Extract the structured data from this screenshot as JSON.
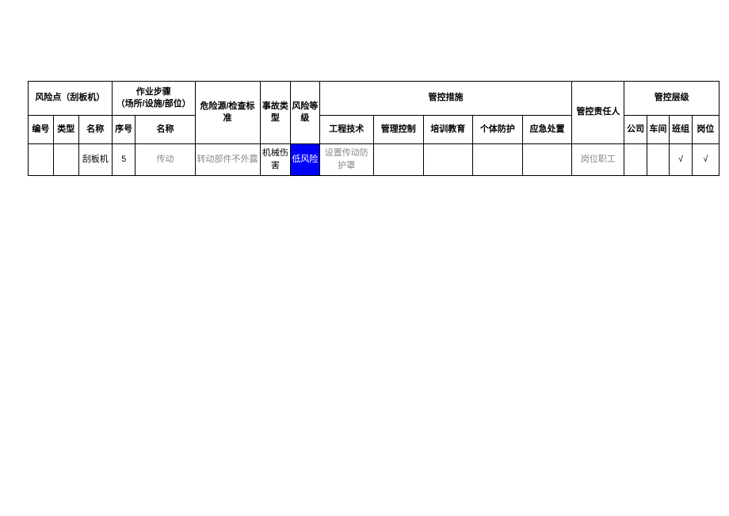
{
  "header": {
    "risk_point": "风险点（刮板机）",
    "operation_step": "作业步骤\n（场所/设施/部位）",
    "hazard_standard": "危险源/检查标准",
    "accident_type": "事故类型",
    "risk_level": "风险等级",
    "control_measures": "管控措施",
    "control_person": "管控责任人",
    "control_level_group": "管控层级",
    "rp_no": "编号",
    "rp_type": "类型",
    "rp_name": "名称",
    "op_no": "序号",
    "op_name": "名称",
    "cm_engineering": "工程技术",
    "cm_management": "管理控制",
    "cm_training": "培训教育",
    "cm_ppe": "个体防护",
    "cm_emergency": "应急处置",
    "lvl_company": "公司",
    "lvl_workshop": "车间",
    "lvl_team": "班组",
    "lvl_post": "岗位"
  },
  "row": {
    "rp_no": "",
    "rp_type": "",
    "rp_name": "刮板机",
    "op_no": "5",
    "op_name": "传动",
    "hazard": "转动部件不外露",
    "accident": "机械伤害",
    "risk": "低风险",
    "eng": "设置传动防护罩",
    "mgmt": "",
    "train": "",
    "ppe": "",
    "emer": "",
    "person": "岗位职工",
    "lvl_company": "",
    "lvl_workshop": "",
    "lvl_team": "√",
    "lvl_post": "√"
  },
  "colors": {
    "risk_low_bg": "#0000ff",
    "risk_low_fg": "#ffffff"
  }
}
